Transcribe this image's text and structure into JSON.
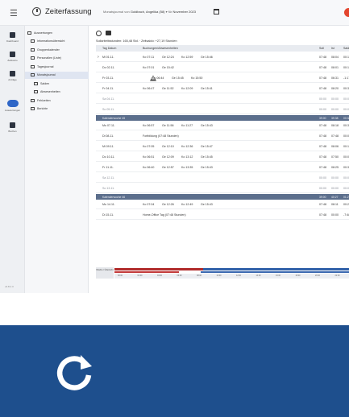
{
  "header": {
    "app_title": "Zeiterfassung",
    "filter_label": "Monatsjournal von",
    "filter_person": "Goldbach, Angelika (58)",
    "filter_for": "für",
    "filter_period": "November 2023"
  },
  "rail": {
    "items": [
      {
        "label": "Dashboard",
        "icon": "grid-icon"
      },
      {
        "label": "Zeitkonto",
        "icon": "grid-icon"
      },
      {
        "label": "Anträge",
        "icon": "document-icon"
      },
      {
        "label": "Auswertungen",
        "icon": "people-icon"
      },
      {
        "label": "Buchen",
        "icon": "pen-icon"
      }
    ],
    "version": "v4.8.1.3"
  },
  "tree": {
    "items": [
      {
        "label": "Auswertungen",
        "level": 0
      },
      {
        "label": "Informationsübersicht",
        "level": 1
      },
      {
        "label": "Gruppenkalender",
        "level": 1
      },
      {
        "label": "Personalien (Liste)",
        "level": 1
      },
      {
        "label": "Tagesjournal",
        "level": 1
      },
      {
        "label": "Monatsjournal",
        "level": 1,
        "selected": true
      },
      {
        "label": "Salden",
        "level": 2
      },
      {
        "label": "Abwesenheiten",
        "level": 2
      },
      {
        "label": "Fehlzeiten",
        "level": 1
      },
      {
        "label": "Berichte",
        "level": 1
      }
    ]
  },
  "summary": "Sollarbeitsstunden: 165,48 Std. · Zeitsaldo: +27,19 Stunden",
  "table": {
    "columns": [
      "Tag Datum",
      "Buchungen/Abwesenheiten",
      "Soll",
      "Ist",
      "Saldo"
    ],
    "rows": [
      {
        "type": "day",
        "day": "Mi 01.11.",
        "times": [
          "Ko 07:11",
          "Ge 12:24",
          "Ko 12:59",
          "Ge 15:46"
        ],
        "soll": "07:48",
        "ist": "08:04",
        "saldo": "00:16",
        "selected": true
      },
      {
        "type": "day",
        "day": "Do 02.11.",
        "times": [
          "Ko 07:01",
          "Ge 15:42"
        ],
        "soll": "07:48",
        "ist": "08:01",
        "saldo": "00:13"
      },
      {
        "type": "day",
        "day": "Fr 03.11.",
        "times": [
          "Ko 06:44",
          "Ge 15:45",
          "Ko 15:50"
        ],
        "soll": "07:48",
        "ist": "06:31",
        "saldo": "-1:17",
        "warning": true
      },
      {
        "type": "day",
        "day": "Fr 04.11.",
        "times": [
          "Ko 06:47",
          "Ge 11:52",
          "Ko 12:09",
          "Ge 15:41"
        ],
        "soll": "07:48",
        "ist": "08:20",
        "saldo": "00:32"
      },
      {
        "type": "day",
        "day": "Sa 04.11.",
        "times": [],
        "soll": "00:00",
        "ist": "00:00",
        "saldo": "00:00",
        "muted": true
      },
      {
        "type": "day",
        "day": "So 05.11.",
        "times": [],
        "soll": "00:00",
        "ist": "00:00",
        "saldo": "00:00",
        "muted": true
      },
      {
        "type": "week",
        "label": "Kalenderwoche 45",
        "soll": "39:00",
        "ist": "39:38",
        "saldo": "00:38"
      },
      {
        "type": "day",
        "day": "Mo 07.11.",
        "times": [
          "Ko 06:57",
          "Ge 11:56",
          "Ko 11:27",
          "Ge 15:43"
        ],
        "soll": "07:48",
        "ist": "08:18",
        "saldo": "00:30"
      },
      {
        "type": "day",
        "day": "Di 08.11.",
        "times": [
          "Fortbildung (07:48 Stunden)"
        ],
        "soll": "07:48",
        "ist": "07:48",
        "saldo": "00:00"
      },
      {
        "type": "day",
        "day": "Mi 09.11.",
        "times": [
          "Ko 07:05",
          "Ge 12:10",
          "Ko 12:36",
          "Ge 15:47"
        ],
        "soll": "07:48",
        "ist": "08:06",
        "saldo": "00:18"
      },
      {
        "type": "day",
        "day": "Do 10.11.",
        "times": [
          "Ko 06:51",
          "Ge 12:09",
          "Ko 13:12",
          "Ge 15:45"
        ],
        "soll": "07:48",
        "ist": "07:50",
        "saldo": "00:02"
      },
      {
        "type": "day",
        "day": "Fr 11.11.",
        "times": [
          "Ko 06:40",
          "Ge 12:57",
          "Ko 13:35",
          "Ge 15:43"
        ],
        "soll": "07:48",
        "ist": "08:25",
        "saldo": "00:37"
      },
      {
        "type": "day",
        "day": "Sa 12.11.",
        "times": [],
        "soll": "00:00",
        "ist": "00:00",
        "saldo": "00:00",
        "muted": true
      },
      {
        "type": "day",
        "day": "So 13.11.",
        "times": [],
        "soll": "00:00",
        "ist": "00:00",
        "saldo": "00:00",
        "muted": true
      },
      {
        "type": "week",
        "label": "Kalenderwoche 46",
        "soll": "39:00",
        "ist": "40:27",
        "saldo": "01:27"
      },
      {
        "type": "day",
        "day": "Mo 14.11.",
        "times": [
          "Ko 07:04",
          "Ge 12:26",
          "Ko 12:49",
          "Ge 15:43"
        ],
        "soll": "07:48",
        "ist": "08:11",
        "saldo": "00:23"
      },
      {
        "type": "day",
        "day": "Di 15.11.",
        "times": [
          "Home-Office Tag (07:48 Stunden)"
        ],
        "soll": "07:48",
        "ist": "00:00",
        "saldo": "-7:48",
        "selected": true
      }
    ]
  },
  "timeline": {
    "label": "Woche / Übersicht",
    "ticks": [
      "00:00",
      "02:00",
      "04:00",
      "06:00",
      "08:00",
      "10:00",
      "12:00",
      "14:00",
      "16:00",
      "18:00",
      "20:00",
      "22:00",
      "24:00"
    ]
  },
  "colors": {
    "banner": "#1e4f8d",
    "week_row": "#5b6e8c",
    "alert": "#e3462f",
    "active_nav": "#2e66c7"
  },
  "banner": {
    "icon": "refresh-icon"
  }
}
